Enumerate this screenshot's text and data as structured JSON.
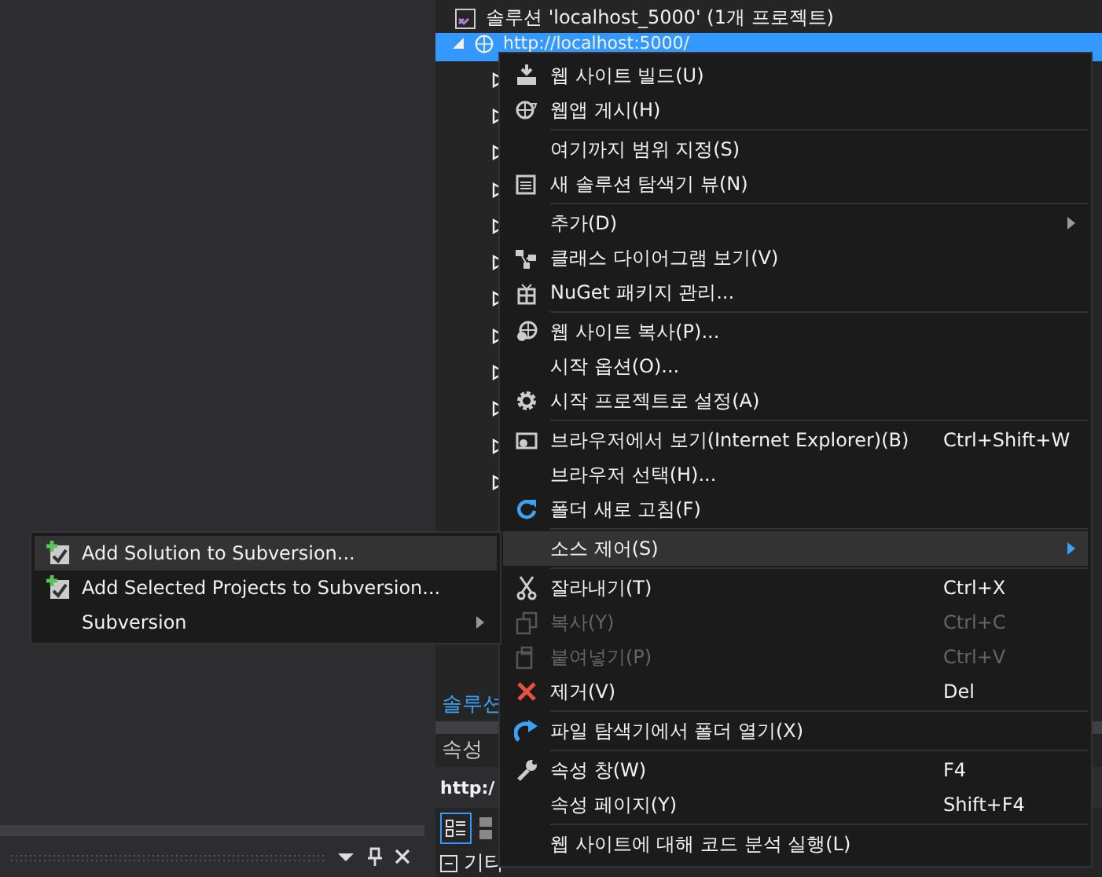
{
  "solution_explorer": {
    "root": {
      "label": "솔루션 'localhost_5000' (1개 프로젝트)"
    },
    "project": {
      "label": "http://localhost:5000/",
      "expanded": true,
      "selected": true,
      "children": [
        {
          "expanded": false
        },
        {
          "expanded": false
        },
        {
          "expanded": false
        },
        {
          "expanded": false
        },
        {
          "expanded": false
        },
        {
          "expanded": false
        },
        {
          "expanded": false
        },
        {
          "expanded": false
        },
        {
          "expanded": false
        },
        {
          "expanded": false
        },
        {
          "expanded": false
        },
        {
          "expanded": false
        }
      ]
    }
  },
  "lower_panels": {
    "solution_tab": "솔루션",
    "properties_title": "속성",
    "properties_object": "http:/",
    "category": "기타"
  },
  "context_menu": [
    {
      "kind": "item",
      "label": "웹 사이트 빌드(U)",
      "selected": false,
      "disabled": false,
      "submenu": false
    },
    {
      "kind": "item",
      "label": "웹앱 게시(H)",
      "selected": false,
      "disabled": false,
      "submenu": false
    },
    {
      "kind": "separator"
    },
    {
      "kind": "item",
      "label": "여기까지 범위 지정(S)",
      "selected": false,
      "disabled": false,
      "submenu": false
    },
    {
      "kind": "item",
      "label": "새 솔루션 탐색기 뷰(N)",
      "selected": false,
      "disabled": false,
      "submenu": false
    },
    {
      "kind": "separator"
    },
    {
      "kind": "item",
      "label": "추가(D)",
      "selected": false,
      "disabled": false,
      "submenu": true
    },
    {
      "kind": "item",
      "label": "클래스 다이어그램 보기(V)",
      "selected": false,
      "disabled": false,
      "submenu": false
    },
    {
      "kind": "item",
      "label": "NuGet 패키지 관리...",
      "selected": false,
      "disabled": false,
      "submenu": false
    },
    {
      "kind": "separator"
    },
    {
      "kind": "item",
      "label": "웹 사이트 복사(P)...",
      "selected": false,
      "disabled": false,
      "submenu": false
    },
    {
      "kind": "item",
      "label": "시작 옵션(O)...",
      "selected": false,
      "disabled": false,
      "submenu": false
    },
    {
      "kind": "item",
      "label": "시작 프로젝트로 설정(A)",
      "selected": false,
      "disabled": false,
      "submenu": false
    },
    {
      "kind": "separator"
    },
    {
      "kind": "item",
      "label": "브라우저에서 보기(Internet Explorer)(B)",
      "shortcut": "Ctrl+Shift+W",
      "selected": false,
      "disabled": false,
      "submenu": false
    },
    {
      "kind": "item",
      "label": "브라우저 선택(H)...",
      "selected": false,
      "disabled": false,
      "submenu": false
    },
    {
      "kind": "item",
      "label": "폴더 새로 고침(F)",
      "selected": false,
      "disabled": false,
      "submenu": false
    },
    {
      "kind": "separator"
    },
    {
      "kind": "item",
      "label": "소스 제어(S)",
      "selected": true,
      "disabled": false,
      "submenu": true
    },
    {
      "kind": "separator"
    },
    {
      "kind": "item",
      "label": "잘라내기(T)",
      "shortcut": "Ctrl+X",
      "selected": false,
      "disabled": false,
      "submenu": false
    },
    {
      "kind": "item",
      "label": "복사(Y)",
      "shortcut": "Ctrl+C",
      "selected": false,
      "disabled": true,
      "submenu": false
    },
    {
      "kind": "item",
      "label": "붙여넣기(P)",
      "shortcut": "Ctrl+V",
      "selected": false,
      "disabled": true,
      "submenu": false
    },
    {
      "kind": "item",
      "label": "제거(V)",
      "shortcut": "Del",
      "selected": false,
      "disabled": false,
      "submenu": false
    },
    {
      "kind": "separator"
    },
    {
      "kind": "item",
      "label": "파일 탐색기에서 폴더 열기(X)",
      "selected": false,
      "disabled": false,
      "submenu": false
    },
    {
      "kind": "separator"
    },
    {
      "kind": "item",
      "label": "속성 창(W)",
      "shortcut": "F4",
      "selected": false,
      "disabled": false,
      "submenu": false
    },
    {
      "kind": "item",
      "label": "속성 페이지(Y)",
      "shortcut": "Shift+F4",
      "selected": false,
      "disabled": false,
      "submenu": false
    },
    {
      "kind": "separator"
    },
    {
      "kind": "item",
      "label": "웹 사이트에 대해 코드 분석 실행(L)",
      "selected": false,
      "disabled": false,
      "submenu": false
    }
  ],
  "source_control_submenu": [
    {
      "label": "Add Solution to Subversion...",
      "selected": true,
      "submenu": false
    },
    {
      "label": "Add Selected Projects to Subversion...",
      "selected": false,
      "submenu": false
    },
    {
      "label": "Subversion",
      "selected": false,
      "submenu": true
    }
  ]
}
